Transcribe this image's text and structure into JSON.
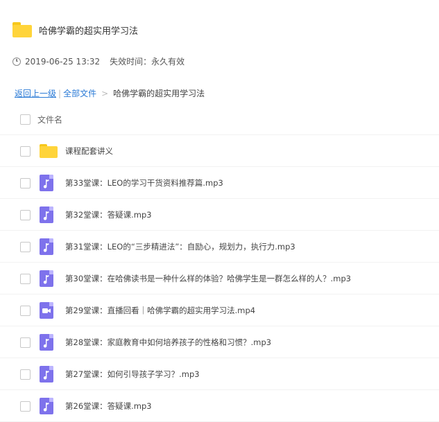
{
  "header": {
    "title": "哈佛学霸的超实用学习法"
  },
  "meta": {
    "datetime": "2019-06-25 13:32",
    "expiry": "失效时间：永久有效"
  },
  "breadcrumb": {
    "back": "返回上一级",
    "sep": "|",
    "all_files": "全部文件",
    "gt": ">",
    "current": "哈佛学霸的超实用学习法"
  },
  "list": {
    "column_header": "文件名",
    "items": [
      {
        "name": "课程配套讲义",
        "type": "folder",
        "icon": "folder-icon"
      },
      {
        "name": "第33堂课：LEO的学习干货资料推荐篇.mp3",
        "type": "audio",
        "icon": "music-file-icon"
      },
      {
        "name": "第32堂课：答疑课.mp3",
        "type": "audio",
        "icon": "music-file-icon"
      },
      {
        "name": "第31堂课：LEO的“三步精进法”：自励心，规划力，执行力.mp3",
        "type": "audio",
        "icon": "music-file-icon"
      },
      {
        "name": "第30堂课：在哈佛读书是一种什么样的体验？哈佛学生是一群怎么样的人？.mp3",
        "type": "audio",
        "icon": "music-file-icon"
      },
      {
        "name": "第29堂课：直播回看｜哈佛学霸的超实用学习法.mp4",
        "type": "video",
        "icon": "video-file-icon"
      },
      {
        "name": "第28堂课：家庭教育中如何培养孩子的性格和习惯？.mp3",
        "type": "audio",
        "icon": "music-file-icon"
      },
      {
        "name": "第27堂课：如何引导孩子学习？.mp3",
        "type": "audio",
        "icon": "music-file-icon"
      },
      {
        "name": "第26堂课：答疑课.mp3",
        "type": "audio",
        "icon": "music-file-icon"
      }
    ]
  },
  "colors": {
    "accent": "#2a7ad6",
    "folder": "#ffd43a",
    "media_icon": "#7e72ec"
  }
}
